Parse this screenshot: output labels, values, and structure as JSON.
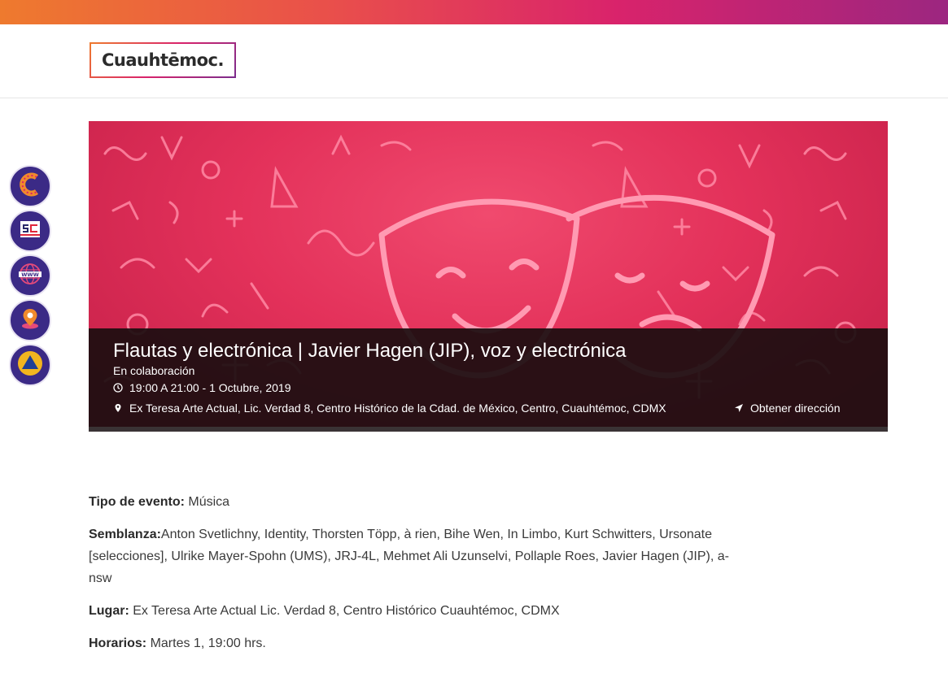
{
  "header": {
    "logo_text": "Cuauhtēmoc."
  },
  "side_nav": [
    {
      "name": "cuauhtemoc-c-icon"
    },
    {
      "name": "sc-icon"
    },
    {
      "name": "www-globe-icon"
    },
    {
      "name": "map-pin-icon"
    },
    {
      "name": "civil-protection-icon"
    }
  ],
  "event": {
    "title": "Flautas y electrónica | Javier Hagen (JIP), voz y electrónica",
    "subtitle": "En colaboración",
    "time": "19:00 A 21:00 - 1 Octubre, 2019",
    "location": "Ex Teresa Arte Actual, Lic. Verdad 8, Centro Histórico de la Cdad. de México, Centro, Cuauhtémoc, CDMX",
    "directions_label": "Obtener dirección"
  },
  "details": {
    "type_label": "Tipo de evento:",
    "type_value": " Música",
    "bio_label": "Semblanza:",
    "bio_value": "Anton Svetlichny, Identity, Thorsten Töpp, à rien, Bihe Wen, In Limbo, Kurt Schwitters, Ursonate [selecciones], Ulrike Mayer-Spohn (UMS), JRJ-4L, Mehmet Ali Uzunselvi, Pollaple Roes, Javier Hagen (JIP), a-nsw",
    "place_label": "Lugar:",
    "place_value": " Ex Teresa Arte Actual Lic. Verdad 8, Centro Histórico Cuauhtémoc, CDMX",
    "schedule_label": "Horarios:",
    "schedule_value": " Martes 1, 19:00 hrs."
  },
  "colors": {
    "accent_purple": "#3b2a86",
    "banner_red": "#e3315a",
    "overlay_dark": "#1c0e10"
  }
}
